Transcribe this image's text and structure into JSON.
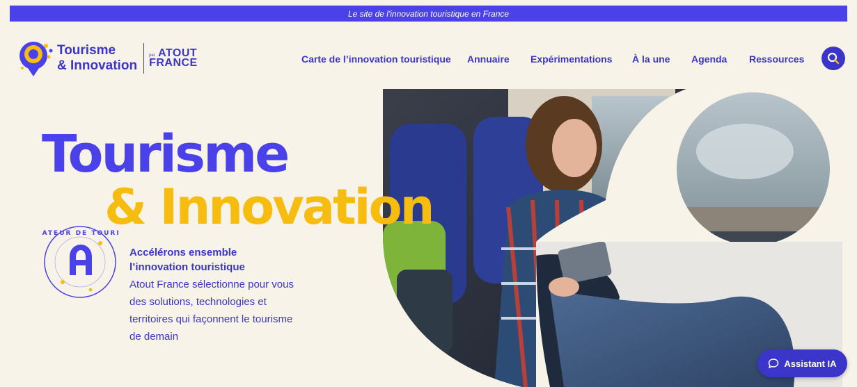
{
  "topbar": {
    "text": "Le site de l'innovation touristique en France"
  },
  "logo": {
    "line1": "Tourisme",
    "line2": "& Innovation",
    "par": "par",
    "atout1": "ATOUT",
    "atout2": "FRANCE"
  },
  "nav": {
    "items": [
      {
        "label": "Carte de l’innovation touristique"
      },
      {
        "label": "Annuaire"
      },
      {
        "label": "Expérimentations"
      },
      {
        "label": "À la une"
      },
      {
        "label": "Agenda"
      },
      {
        "label": "Ressources"
      }
    ]
  },
  "search": {
    "icon": "search-icon"
  },
  "hero": {
    "title_line1": "Tourisme",
    "title_line2": "& Innovation",
    "badge_text": "ACTIVATEUR DE TOURISMES",
    "tagline_title_1": "Accélérons ensemble",
    "tagline_title_2": "l’innovation touristique",
    "tagline_body": "Atout France sélectionne pour vous des solutions, technologies et territoires qui façonnent le tourisme de demain"
  },
  "assistant": {
    "label": "Assistant IA",
    "icon": "chat-bubble-icon"
  },
  "colors": {
    "primary": "#4a42e8",
    "navy": "#3b35c9",
    "yellow": "#f6bd10",
    "cream": "#f8f3e8"
  }
}
